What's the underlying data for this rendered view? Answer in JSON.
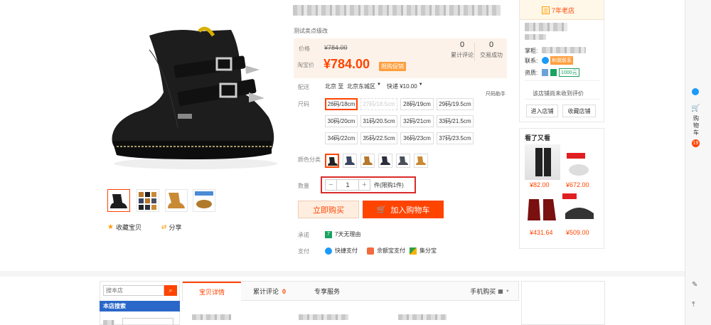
{
  "product": {
    "subtitle": "测试卖点级改",
    "price_label": "价格",
    "price_old": "¥784.00",
    "promo_label": "淘宝价",
    "price_new": "¥784.00",
    "promo_badge": "限购促销",
    "stats": [
      {
        "value": "0",
        "label": "累计评论"
      },
      {
        "value": "0",
        "label": "交易成功"
      }
    ]
  },
  "delivery": {
    "label": "配送",
    "from": "北京 至",
    "to": "北京东城区",
    "shipping": "快递 ¥10.00",
    "size_helper": "尺码助手"
  },
  "sizes": {
    "label": "尺码",
    "options": [
      {
        "text": "26码/18cm",
        "state": "selected"
      },
      {
        "text": "27码/18.5cm",
        "state": "disabled"
      },
      {
        "text": "28码/19cm",
        "state": "normal"
      },
      {
        "text": "29码/19.5cm",
        "state": "normal"
      },
      {
        "text": "30码/20cm",
        "state": "normal"
      },
      {
        "text": "31码/20.5cm",
        "state": "normal"
      },
      {
        "text": "32码/21cm",
        "state": "normal"
      },
      {
        "text": "33码/21.5cm",
        "state": "normal"
      },
      {
        "text": "34码/22cm",
        "state": "normal"
      },
      {
        "text": "35码/22.5cm",
        "state": "normal"
      },
      {
        "text": "36码/23cm",
        "state": "normal"
      },
      {
        "text": "37码/23.5cm",
        "state": "normal"
      }
    ]
  },
  "colors": {
    "label": "颜色分类",
    "swatches": [
      "#222222",
      "#3a4660",
      "#b8772a",
      "#2a2f3a",
      "#4a4f5a",
      "#c98a34"
    ]
  },
  "quantity": {
    "label": "数量",
    "minus": "−",
    "value": "1",
    "plus": "+",
    "unit": "件(限购1件)"
  },
  "actions": {
    "buy_now": "立即购买",
    "add_cart": "加入购物车"
  },
  "promise": {
    "label": "承诺",
    "text": "7天无理由"
  },
  "payment": {
    "label": "支付",
    "methods": [
      "快捷支付",
      "余额宝支付",
      "集分宝"
    ]
  },
  "gallery": {
    "favorite": "收藏宝贝",
    "share": "分享"
  },
  "shop": {
    "years": "7年老店",
    "owner_label": "掌柜:",
    "contact_label": "联系:",
    "contact_btn": "和我联系",
    "deposit_label": "资质:",
    "deposit_value": "1000元",
    "no_rating": "该店铺尚未收到评价",
    "enter_shop": "进入店铺",
    "fav_shop": "收藏店铺"
  },
  "recommend": {
    "title": "看了又看",
    "items": [
      {
        "price": "¥82.00"
      },
      {
        "price": "¥672.00"
      },
      {
        "price": "¥431.64"
      },
      {
        "price": "¥509.00"
      }
    ]
  },
  "sidebar": {
    "cart_label": "购物车",
    "cart_count": "19"
  },
  "bottom": {
    "search_placeholder": "搜本店",
    "store_search": "本店搜索",
    "tabs": [
      "宝贝详情",
      "累计评论",
      "专享服务"
    ],
    "review_count": "0",
    "mobile_buy": "手机购买"
  },
  "colors_theme": {
    "accent": "#ff4400",
    "price_bg": "#fdf2e9"
  }
}
